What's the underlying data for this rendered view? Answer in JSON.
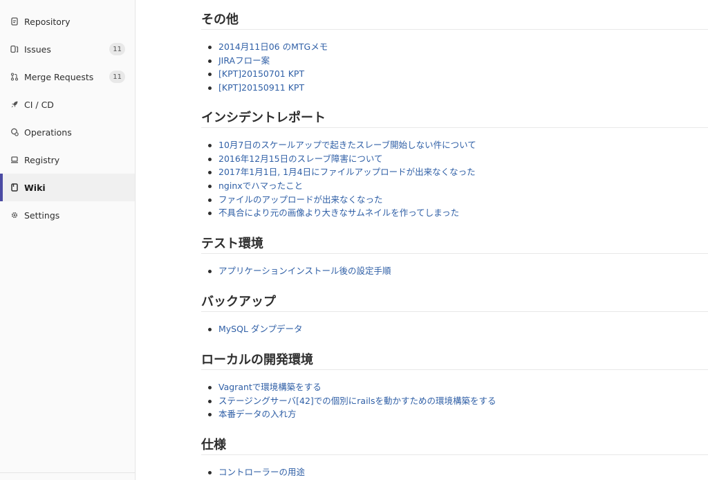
{
  "sidebar": {
    "items": [
      {
        "label": "Repository",
        "icon": "repository-icon"
      },
      {
        "label": "Issues",
        "icon": "issues-icon",
        "badge": "11"
      },
      {
        "label": "Merge Requests",
        "icon": "merge-request-icon",
        "badge": "11"
      },
      {
        "label": "CI / CD",
        "icon": "rocket-icon"
      },
      {
        "label": "Operations",
        "icon": "operations-icon"
      },
      {
        "label": "Registry",
        "icon": "registry-icon"
      },
      {
        "label": "Wiki",
        "icon": "wiki-icon",
        "active": true
      },
      {
        "label": "Settings",
        "icon": "gear-icon"
      }
    ],
    "accent_color": "#4b4ba3"
  },
  "sections": [
    {
      "title": "その他",
      "links": [
        "2014月11日06 のMTGメモ",
        "JIRAフロー案",
        "[KPT]20150701 KPT",
        "[KPT]20150911 KPT"
      ]
    },
    {
      "title": "インシデントレポート",
      "links": [
        "10月7日のスケールアップで起きたスレーブ開始しない件について",
        "2016年12月15日のスレーブ障害について",
        "2017年1月1日, 1月4日にファイルアップロードが出来なくなった",
        "nginxでハマったこと",
        "ファイルのアップロードが出来なくなった",
        "不具合により元の画像より大きなサムネイルを作ってしまった"
      ]
    },
    {
      "title": "テスト環境",
      "links": [
        "アプリケーションインストール後の設定手順"
      ]
    },
    {
      "title": "バックアップ",
      "links": [
        "MySQL ダンプデータ"
      ]
    },
    {
      "title": "ローカルの開発環境",
      "links": [
        "Vagrantで環境構築をする",
        "ステージングサーバ[42]での個別にrailsを動かすための環境構築をする",
        "本番データの入れ方"
      ]
    },
    {
      "title": "仕様",
      "links": [
        "コントローラーの用途"
      ]
    }
  ],
  "link_color": "#2f5fa6"
}
